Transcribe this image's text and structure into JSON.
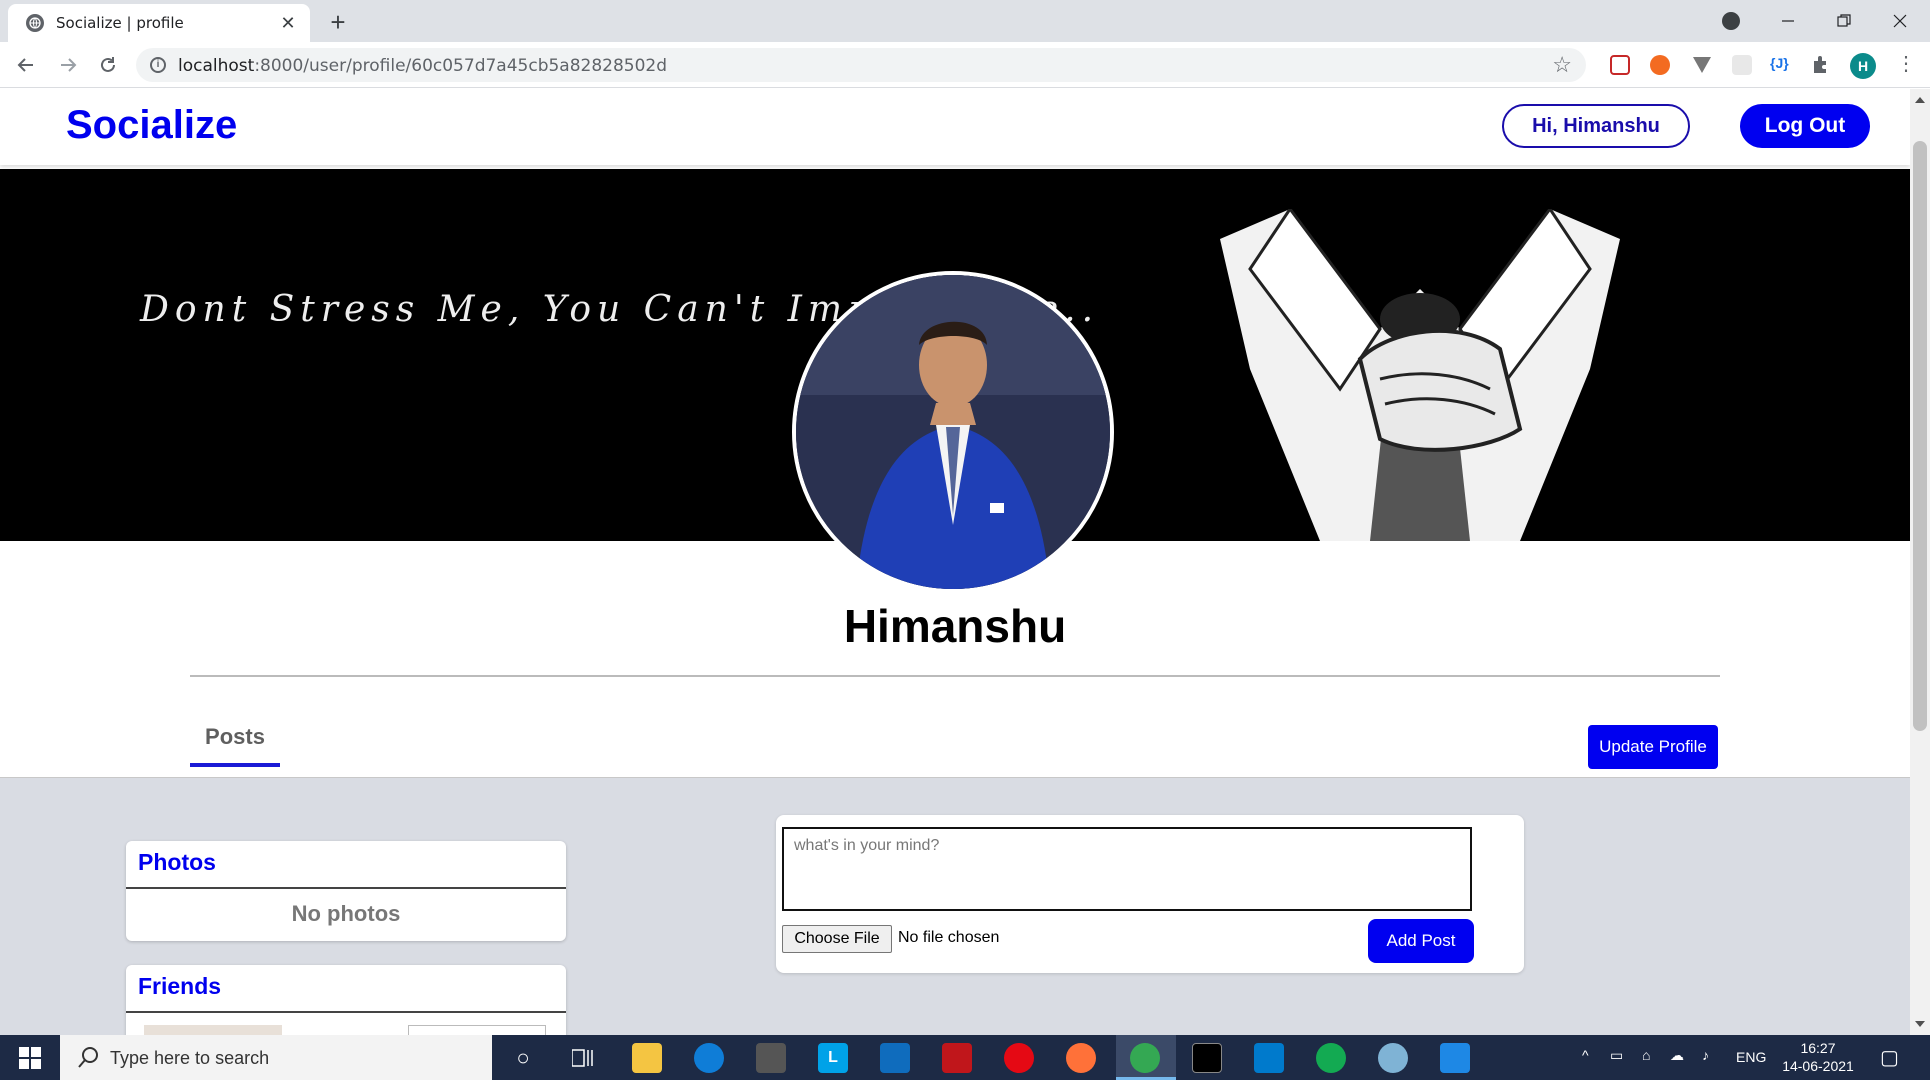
{
  "browser": {
    "tab_title": "Socialize | profile",
    "url_host": "localhost",
    "url_rest": ":8000/user/profile/60c057d7a45cb5a82828502d",
    "profile_initial": "H"
  },
  "header": {
    "brand": "Socialize",
    "greeting": "Hi, Himanshu",
    "logout": "Log Out"
  },
  "cover": {
    "quote": "Dont Stress Me, You Can't Impress Me.."
  },
  "profile": {
    "name": "Himanshu",
    "tab_posts": "Posts",
    "update_button": "Update Profile"
  },
  "sidebar": {
    "photos_title": "Photos",
    "photos_empty": "No photos",
    "friends_title": "Friends"
  },
  "composer": {
    "placeholder": "what's in your mind?",
    "choose_file": "Choose File",
    "no_file": "No file chosen",
    "add_post": "Add Post"
  },
  "taskbar": {
    "search_placeholder": "Type here to search",
    "language": "ENG",
    "time": "16:27",
    "date": "14-06-2021"
  },
  "colors": {
    "brand_blue": "#0000ee",
    "button_blue": "#0000f0",
    "content_bg": "#d9dce3"
  }
}
